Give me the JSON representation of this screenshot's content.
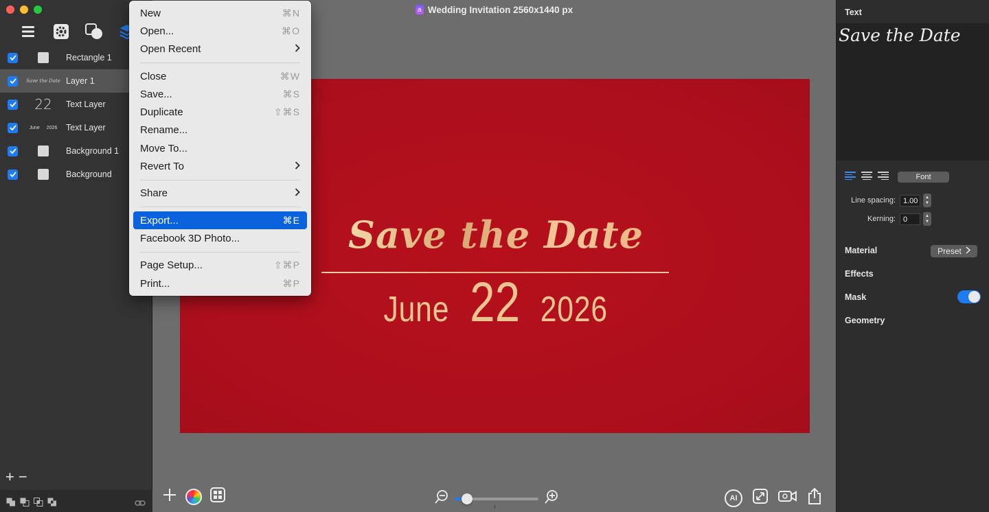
{
  "window": {
    "title": "Wedding Invitation 2560x1440 px",
    "app_icon_glyph": "a"
  },
  "layers": [
    {
      "name": "Rectangle 1",
      "thumb": "square",
      "checked": true,
      "selected": false
    },
    {
      "name": "Layer 1",
      "thumb": "script",
      "thumb_text": "Save the Date",
      "checked": true,
      "selected": true
    },
    {
      "name": "Text Layer",
      "thumb": "big",
      "thumb_text": "22",
      "checked": true,
      "selected": false
    },
    {
      "name": "Text Layer",
      "thumb": "pair",
      "thumb_text_a": "June",
      "thumb_text_b": "2026",
      "checked": true,
      "selected": false
    },
    {
      "name": "Background 1",
      "thumb": "square",
      "checked": true,
      "selected": false
    },
    {
      "name": "Background",
      "thumb": "square",
      "checked": true,
      "selected": false
    }
  ],
  "sidebar_actions": {
    "add": "+",
    "remove": "−"
  },
  "canvas": {
    "headline": "Save the Date",
    "month": "June",
    "day": "22",
    "year": "2026",
    "zoom": 0.15
  },
  "menu": {
    "groups": [
      [
        {
          "label": "New",
          "shortcut": "⌘N"
        },
        {
          "label": "Open...",
          "shortcut": "⌘O"
        },
        {
          "label": "Open Recent",
          "submenu": true
        }
      ],
      [
        {
          "label": "Close",
          "shortcut": "⌘W"
        },
        {
          "label": "Save...",
          "shortcut": "⌘S"
        },
        {
          "label": "Duplicate",
          "shortcut": "⇧⌘S"
        },
        {
          "label": "Rename..."
        },
        {
          "label": "Move To..."
        },
        {
          "label": "Revert To",
          "submenu": true
        }
      ],
      [
        {
          "label": "Share",
          "submenu": true
        }
      ],
      [
        {
          "label": "Export...",
          "shortcut": "⌘E",
          "highlighted": true
        },
        {
          "label": "Facebook 3D Photo..."
        }
      ],
      [
        {
          "label": "Page Setup...",
          "shortcut": "⇧⌘P"
        },
        {
          "label": "Print...",
          "shortcut": "⌘P"
        }
      ]
    ]
  },
  "inspector": {
    "title": "Text",
    "preview_text": "Save the Date",
    "font_label": "Font",
    "line_spacing_label": "Line spacing:",
    "line_spacing_value": "1.00",
    "kerning_label": "Kerning:",
    "kerning_value": "0",
    "material_label": "Material",
    "preset_label": "Preset",
    "effects_label": "Effects",
    "mask_label": "Mask",
    "mask_on": true,
    "geometry_label": "Geometry",
    "ai_label": "AI"
  },
  "colors": {
    "accent": "#1f7cf0",
    "artboard": "#b0101d",
    "gold": "#ecc591",
    "menu_highlight": "#0a63dc"
  }
}
